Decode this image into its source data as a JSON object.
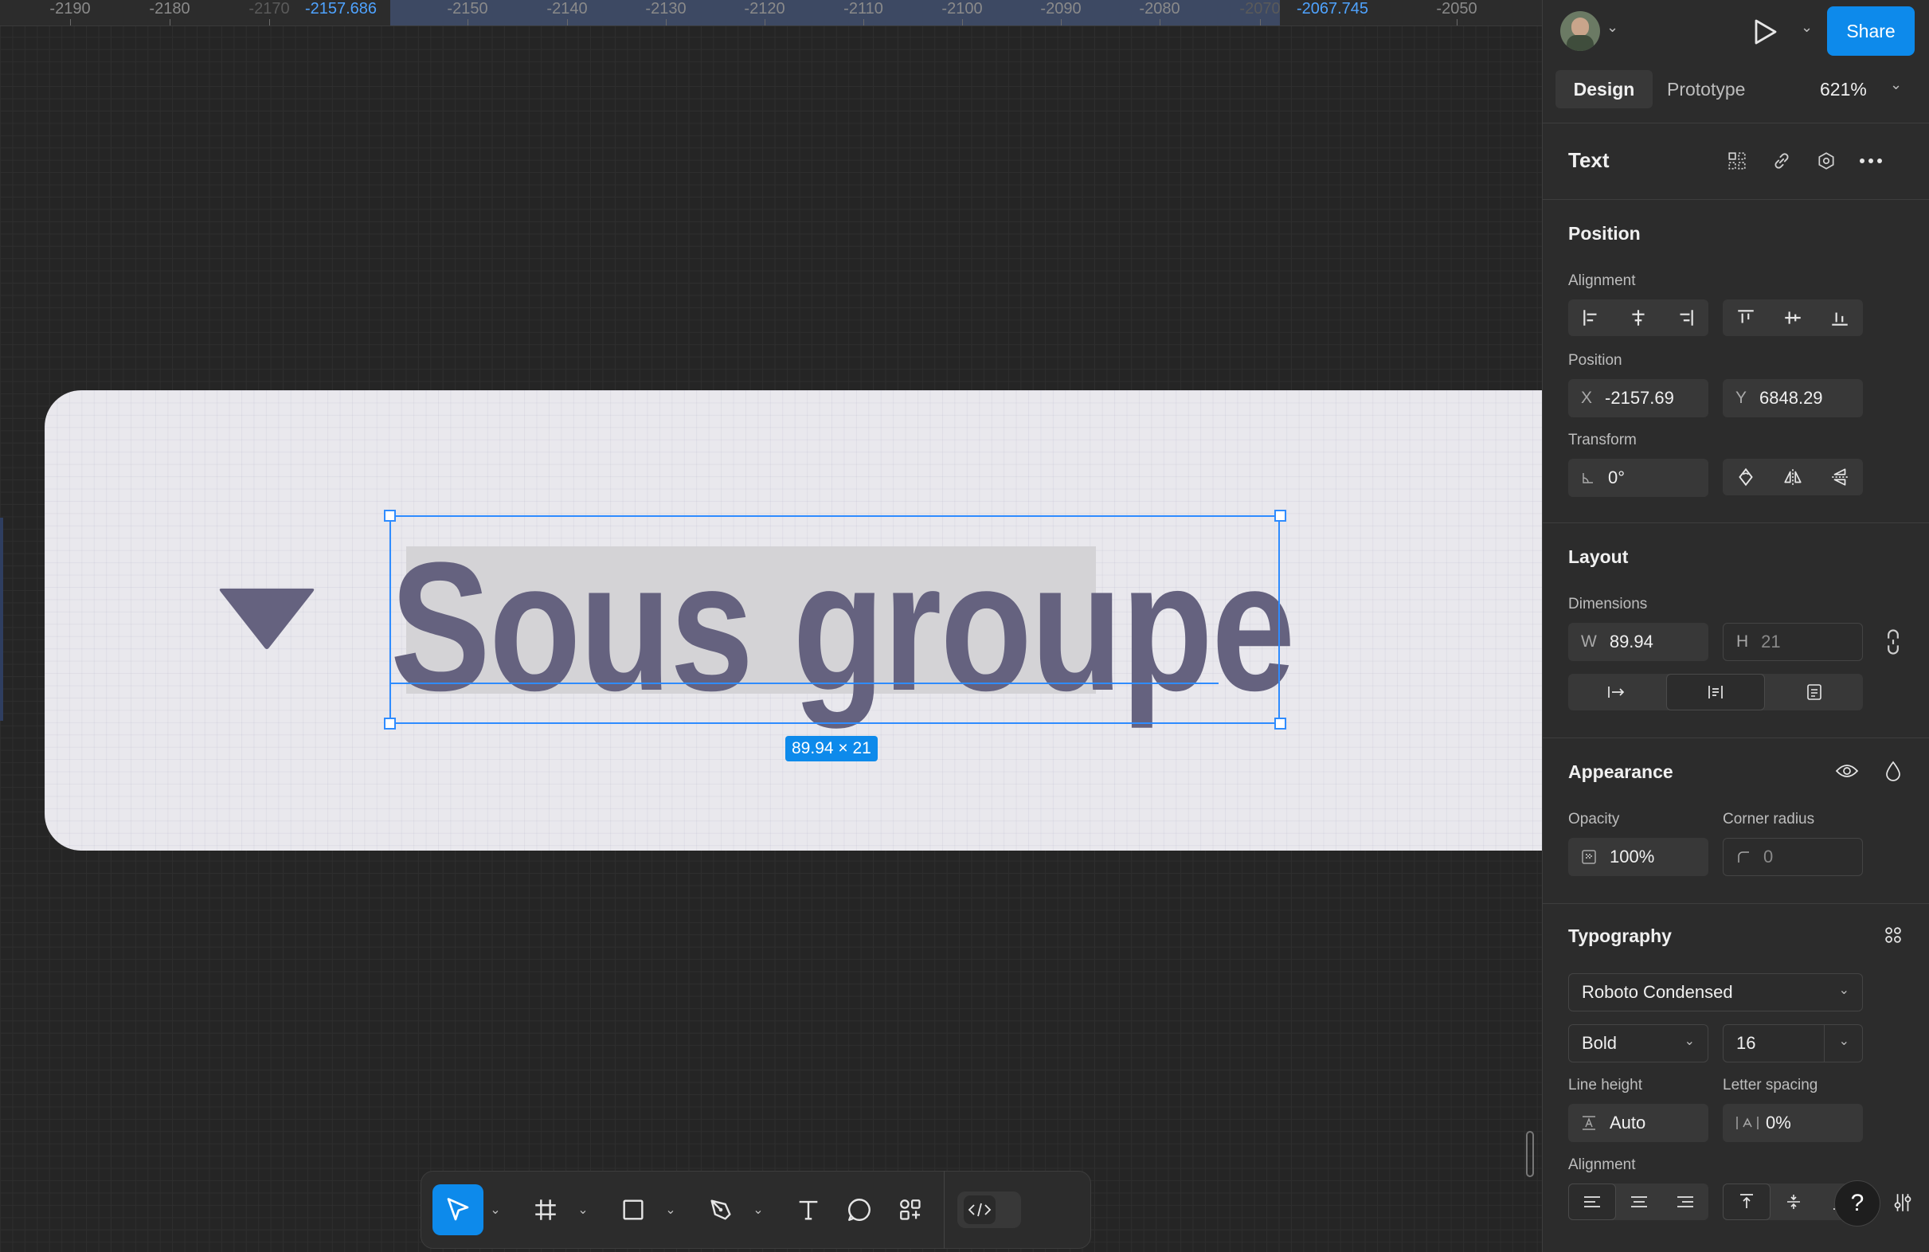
{
  "ruler": {
    "ticks": [
      "-2190",
      "-2180",
      "-2170",
      "-2150",
      "-2140",
      "-2130",
      "-2120",
      "-2110",
      "-2100",
      "-2090",
      "-2080",
      "-2070",
      "-2050"
    ],
    "sel_start": "-2157.686",
    "sel_end": "-2067.745"
  },
  "canvas": {
    "text": "Sous groupe",
    "dimension_badge": "89.94 × 21"
  },
  "header": {
    "share": "Share",
    "tab_design": "Design",
    "tab_prototype": "Prototype",
    "zoom": "621%"
  },
  "panel": {
    "layer_type": "Text",
    "position": {
      "title": "Position",
      "alignment_label": "Alignment",
      "position_label": "Position",
      "x_prefix": "X",
      "x": "-2157.69",
      "y_prefix": "Y",
      "y": "6848.29",
      "transform_label": "Transform",
      "rotation": "0°"
    },
    "layout": {
      "title": "Layout",
      "dimensions_label": "Dimensions",
      "w_prefix": "W",
      "w": "89.94",
      "h_prefix": "H",
      "h": "21"
    },
    "appearance": {
      "title": "Appearance",
      "opacity_label": "Opacity",
      "opacity": "100%",
      "corner_label": "Corner radius",
      "corner": "0"
    },
    "typography": {
      "title": "Typography",
      "font": "Roboto Condensed",
      "weight": "Bold",
      "size": "16",
      "line_height_label": "Line height",
      "line_height": "Auto",
      "letter_spacing_label": "Letter spacing",
      "letter_spacing": "0%",
      "alignment_label": "Alignment"
    }
  },
  "colors": {
    "accent": "#0d8aeb",
    "selection": "#2f8cff",
    "text_fill": "#65627f",
    "frame_fill": "#e9e8ed"
  }
}
